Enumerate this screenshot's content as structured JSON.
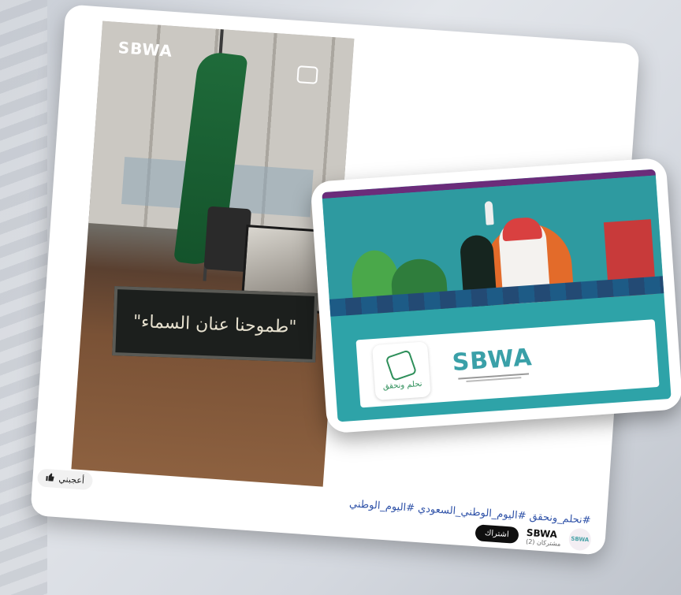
{
  "video": {
    "watermark_logo": "SBWA",
    "nameplate_text": "\"طموحنا عنان السماء\""
  },
  "post": {
    "hashtags": "#نحلم_ونحقق #اليوم_الوطني_السعودي #اليوم_الوطني",
    "like_label": "أعجبني"
  },
  "channel": {
    "name": "SBWA",
    "subscribers": "مشتركان (2)",
    "subscribe_label": "اشتراك",
    "avatar_text": "SBWA"
  },
  "banner": {
    "org_name": "SBWA",
    "tile_text": "نحلم ونحقق"
  },
  "colors": {
    "hashtag": "#2f52a8",
    "banner_teal": "#2ea3a8",
    "subscribe_bg": "#0f0f0f"
  }
}
